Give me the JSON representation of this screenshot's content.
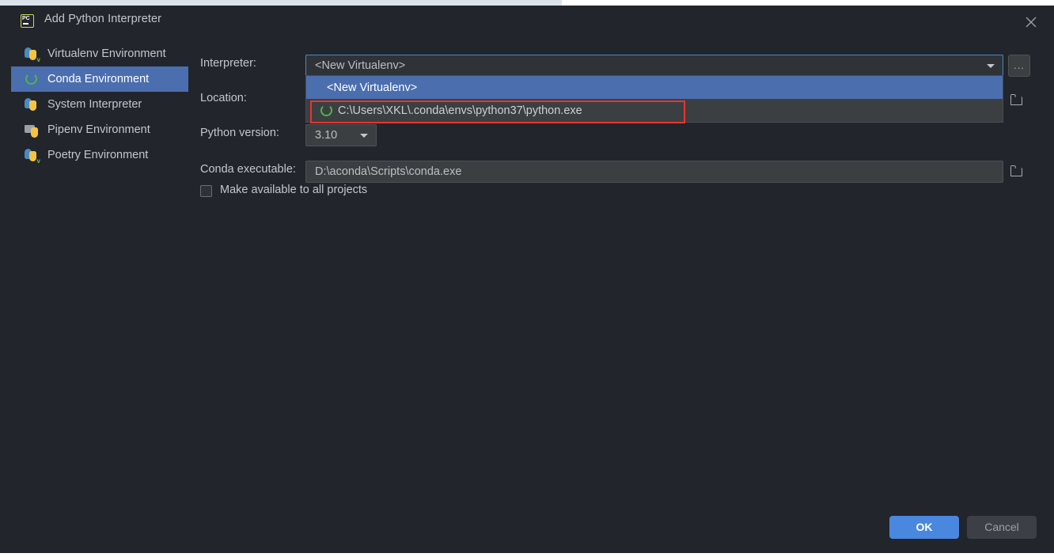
{
  "window": {
    "title": "Add Python Interpreter",
    "app_icon": "pycharm-icon",
    "close_icon": "close-icon"
  },
  "sidebar": {
    "items": [
      {
        "label": "Virtualenv Environment",
        "icon": "python-virtualenv-icon",
        "selected": false
      },
      {
        "label": "Conda Environment",
        "icon": "conda-icon",
        "selected": true
      },
      {
        "label": "System Interpreter",
        "icon": "python-icon",
        "selected": false
      },
      {
        "label": "Pipenv Environment",
        "icon": "pipenv-folder-icon",
        "selected": false
      },
      {
        "label": "Poetry Environment",
        "icon": "python-poetry-icon",
        "selected": false
      }
    ]
  },
  "form": {
    "interpreter": {
      "label": "Interpreter:",
      "value": "<New Virtualenv>",
      "arrow_icon": "chevron-down-icon",
      "browse_label": "...",
      "browse_icon": "ellipsis-icon"
    },
    "location": {
      "label": "Location:",
      "value": "",
      "folder_icon": "folder-icon"
    },
    "python_version": {
      "label": "Python version:",
      "value": "3.10",
      "arrow_icon": "chevron-down-icon"
    },
    "conda_executable": {
      "label": "Conda executable:",
      "value": "D:\\aconda\\Scripts\\conda.exe",
      "folder_icon": "folder-icon"
    },
    "make_available": {
      "label": "Make available to all projects",
      "checked": false
    }
  },
  "dropdown": {
    "open": true,
    "items": [
      {
        "label": "<New Virtualenv>",
        "icon": "",
        "highlighted": true
      },
      {
        "label": "C:\\Users\\XKL\\.conda\\envs\\python37\\python.exe",
        "icon": "conda-icon",
        "highlighted": false
      }
    ]
  },
  "annotation": {
    "color": "#e8352e",
    "target": "conda-env-interpreter-option"
  },
  "footer": {
    "ok_label": "OK",
    "cancel_label": "Cancel"
  },
  "colors": {
    "dialog_bg": "#22252b",
    "field_bg": "#3c3f41",
    "selection_blue": "#4b6eaf",
    "accent_blue": "#4a88e0",
    "text": "#c3c7cd",
    "top_strip": "#dde3ea"
  }
}
